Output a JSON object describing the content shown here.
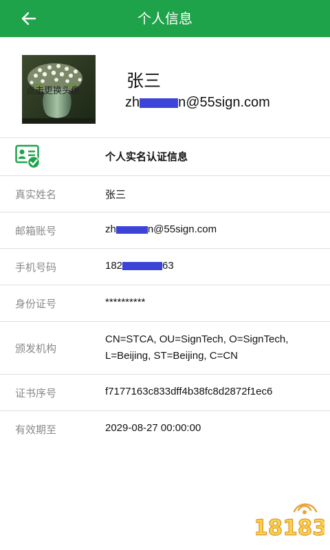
{
  "header": {
    "title": "个人信息",
    "back_icon": "arrow-left-icon",
    "bg_color": "#1fa34a"
  },
  "profile": {
    "avatar_tip": "点击更换头像",
    "name": "张三",
    "email_prefix": "zh",
    "email_suffix": "n@55sign.com"
  },
  "section": {
    "icon": "certificate-check-icon",
    "title": "个人实名认证信息"
  },
  "rows": {
    "real_name": {
      "label": "真实姓名",
      "value": "张三"
    },
    "email": {
      "label": "邮箱账号",
      "prefix": "zh",
      "suffix": "n@55sign.com"
    },
    "phone": {
      "label": "手机号码",
      "prefix": "182",
      "suffix": "63"
    },
    "id_number": {
      "label": "身份证号",
      "value": "**********"
    },
    "issuer": {
      "label": "颁发机构",
      "line1": "CN=STCA, OU=SignTech, O=SignTech,",
      "line2": "L=Beijing, ST=Beijing, C=CN"
    },
    "serial": {
      "label": "证书序号",
      "value": "f7177163c833dff4b38fc8d2872f1ec6"
    },
    "validity": {
      "label": "有效期至",
      "value": "2029-08-27 00:00:00"
    }
  },
  "watermark": {
    "text": "18183"
  },
  "colors": {
    "accent": "#1fa34a",
    "redaction": "#3b44d6",
    "label": "#888888"
  }
}
